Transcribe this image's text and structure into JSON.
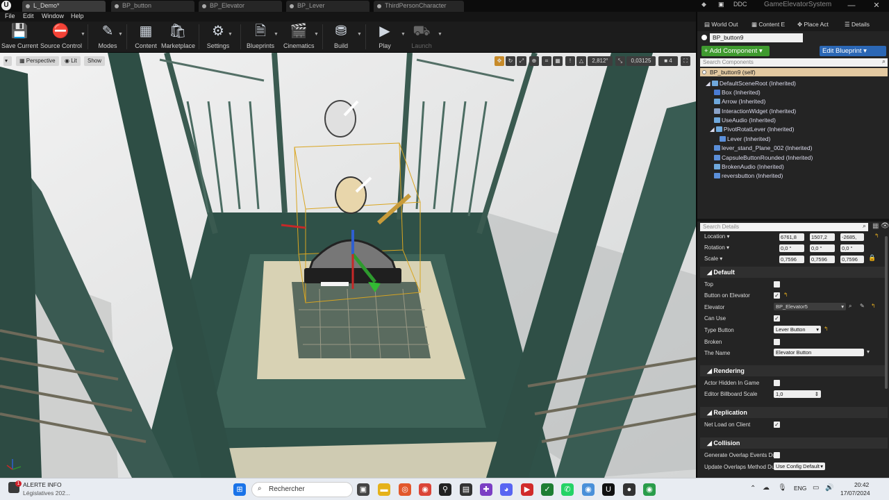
{
  "titlebar": {
    "tabs": [
      {
        "label": "L_Demo*"
      },
      {
        "label": "BP_button"
      },
      {
        "label": "BP_Elevator"
      },
      {
        "label": "BP_Lever"
      },
      {
        "label": "ThirdPersonCharacter"
      }
    ],
    "ddc_label": "DDC",
    "project_name": "GameElevatorSystem",
    "min_symbol": "—",
    "max_symbol": "☐",
    "close_symbol": "✕"
  },
  "menubar": {
    "items": [
      "File",
      "Edit",
      "Window",
      "Help"
    ]
  },
  "toolbar": {
    "buttons": [
      {
        "label": "Save Current",
        "icon": "save-icon"
      },
      {
        "label": "Source Control",
        "icon": "source-control-icon"
      },
      {
        "label": "Modes",
        "icon": "modes-icon"
      },
      {
        "label": "Content",
        "icon": "content-icon"
      },
      {
        "label": "Marketplace",
        "icon": "marketplace-icon"
      },
      {
        "label": "Settings",
        "icon": "settings-icon"
      },
      {
        "label": "Blueprints",
        "icon": "blueprints-icon"
      },
      {
        "label": "Cinematics",
        "icon": "cinematics-icon"
      },
      {
        "label": "Build",
        "icon": "build-icon"
      },
      {
        "label": "Play",
        "icon": "play-icon"
      },
      {
        "label": "Launch",
        "icon": "launch-icon",
        "disabled": true
      }
    ]
  },
  "viewport": {
    "perspective_label": "Perspective",
    "lit_label": "Lit",
    "show_label": "Show",
    "rotation_snap": "2,812°",
    "scale_snap": "0,03125",
    "camera_speed": "4"
  },
  "panel_tabs": [
    "World Out",
    "Content E",
    "Place Act",
    "Details"
  ],
  "components": {
    "blueprint_name": "BP_button9",
    "add_component_label": "+ Add Component ▾",
    "edit_blueprint_label": "Edit Blueprint ▾",
    "search_placeholder": "Search Components",
    "self_label": "BP_button9 (self)",
    "tree": [
      {
        "label": "DefaultSceneRoot (Inherited)"
      },
      {
        "label": "Box (Inherited)"
      },
      {
        "label": "Arrow (Inherited)"
      },
      {
        "label": "InteractionWidget (Inherited)"
      },
      {
        "label": "UseAudio (Inherited)"
      },
      {
        "label": "PivotRotatLever (Inherited)"
      },
      {
        "label": "Lever (Inherited)"
      },
      {
        "label": "lever_stand_Plane_002 (Inherited)"
      },
      {
        "label": "CapsuleButtonRounded (Inherited)"
      },
      {
        "label": "BrokenAudio (Inherited)"
      },
      {
        "label": "reversbutton (Inherited)"
      }
    ]
  },
  "details": {
    "search_placeholder": "Search Details",
    "transform": {
      "location_label": "Location ▾",
      "location": [
        "6761,8",
        "1507,2",
        "-2685,"
      ],
      "rotation_label": "Rotation ▾",
      "rotation": [
        "0,0 °",
        "0,0 °",
        "0,0 °"
      ],
      "scale_label": "Scale ▾",
      "scale": [
        "0,7596",
        "0,7596",
        "0,7596"
      ]
    },
    "categories": {
      "default": "Default",
      "rendering": "Rendering",
      "replication": "Replication",
      "collision": "Collision"
    },
    "props": {
      "top": "Top",
      "button_on_elevator": "Button on Elevator",
      "elevator": "Elevator",
      "elevator_value": "BP_Elevator5",
      "can_use": "Can Use",
      "type_button": "Type Button",
      "type_button_value": "Lever Button",
      "broken": "Broken",
      "the_name": "The Name",
      "the_name_value": "Elevator Button",
      "actor_hidden": "Actor Hidden In Game",
      "billboard_scale": "Editor Billboard Scale",
      "billboard_value": "1,0",
      "net_load": "Net Load on Client",
      "gen_overlap": "Generate Overlap Events Du",
      "update_overlaps": "Update Overlaps Method Du",
      "update_overlaps_value": "Use Config Default"
    }
  },
  "taskbar": {
    "news_title": "ALERTE INFO",
    "news_sub": "Législatives 202...",
    "notification_count": "1",
    "search_placeholder": "Rechercher",
    "language": "ENG",
    "time": "20:42",
    "date": "17/07/2024"
  },
  "colors": {
    "add_component": "#3f9a2f",
    "edit_blueprint": "#2b67b5",
    "self_row": "#e3c9a1",
    "axis_x": "#c62828",
    "axis_y": "#2e8b2e",
    "axis_z": "#2f5fd0"
  }
}
